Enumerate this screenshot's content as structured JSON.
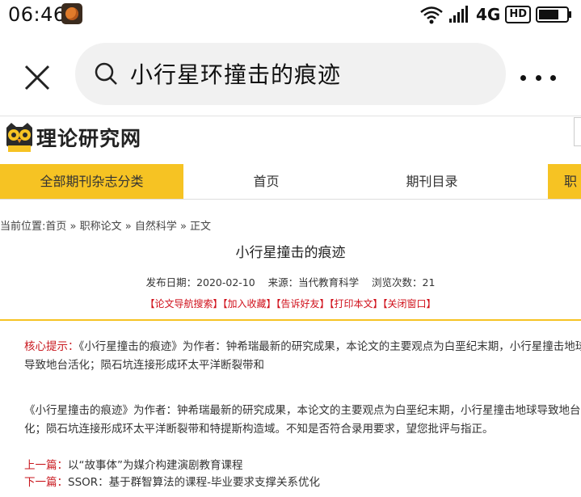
{
  "status_bar": {
    "time": "06:46",
    "network": "4G",
    "hd": "HD"
  },
  "browser": {
    "search_query": "小行星环撞击的痕迹"
  },
  "site": {
    "logo_text": "理论研究网"
  },
  "nav": {
    "items": [
      "全部期刊杂志分类",
      "首页",
      "期刊目录",
      "职"
    ]
  },
  "breadcrumb": {
    "prefix": "当前位置:",
    "path": "首页 » 职称论文 » 自然科学 » 正文"
  },
  "article": {
    "title": "小行星撞击的痕迹",
    "meta": "发布日期：2020-02-10    来源：当代教育科学    浏览次数：21",
    "links": "【论文导航搜索】【加入收藏】【告诉好友】【打印本文】【关闭窗口】",
    "summary_label": "核心提示：",
    "summary_line1": "《小行星撞击的痕迹》为作者：钟希瑞最新的研究成果，本论文的主要观点为白垩纪末期，小行星撞击地球",
    "summary_line2": "导致地台活化；陨石坑连接形成环太平洋断裂带和",
    "body_line1": "《小行星撞击的痕迹》为作者：钟希瑞最新的研究成果，本论文的主要观点为白垩纪末期，小行星撞击地球导致地台活",
    "body_line2": "化；陨石坑连接形成环太平洋断裂带和特提斯构造域。不知是否符合录用要求，望您批评与指正。",
    "prev_label": "上一篇：",
    "prev_title": "以“故事体”为媒介构建演剧教育课程",
    "next_label": "下一篇：",
    "next_title": "SSOR：基于群智算法的课程-毕业要求支撑关系优化"
  },
  "colors": {
    "accent_yellow": "#f6c323",
    "link_red": "#d0101b"
  }
}
